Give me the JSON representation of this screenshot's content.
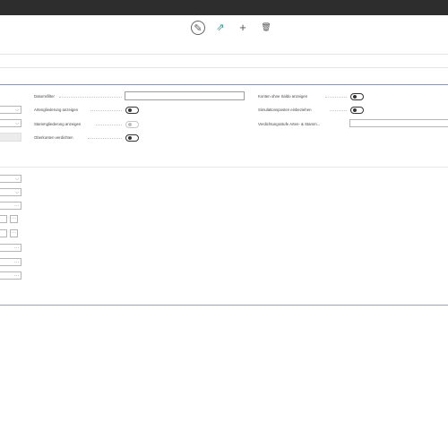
{
  "toolbar": {
    "edit_icon": "pencil-icon",
    "share_icon": "share-icon",
    "add_icon": "plus-icon",
    "delete_icon": "trash-icon"
  },
  "filters": {
    "datumsfilter_label": "Datumsfilter",
    "datumsfilter_value": "",
    "artengliederung_label": "Artengliederung anzeigen",
    "stammgliederung_label": "Stammgliederung anzeigen",
    "oberkonten_label": "Oberkonten verdichten",
    "konten_ohne_saldo_label": "Konten ohne Saldo anzeigen",
    "simulationsposten_label": "Simulationsposten einbeziehen",
    "verdichtungsstufe_label": "Verdichtungsstufe Arten- & Stamm...",
    "verdichtungsstufe_value": ""
  },
  "colors": {
    "topbar": "#2d2d2d",
    "accent": "#3a8f8a",
    "section_line": "#8a97b0"
  }
}
